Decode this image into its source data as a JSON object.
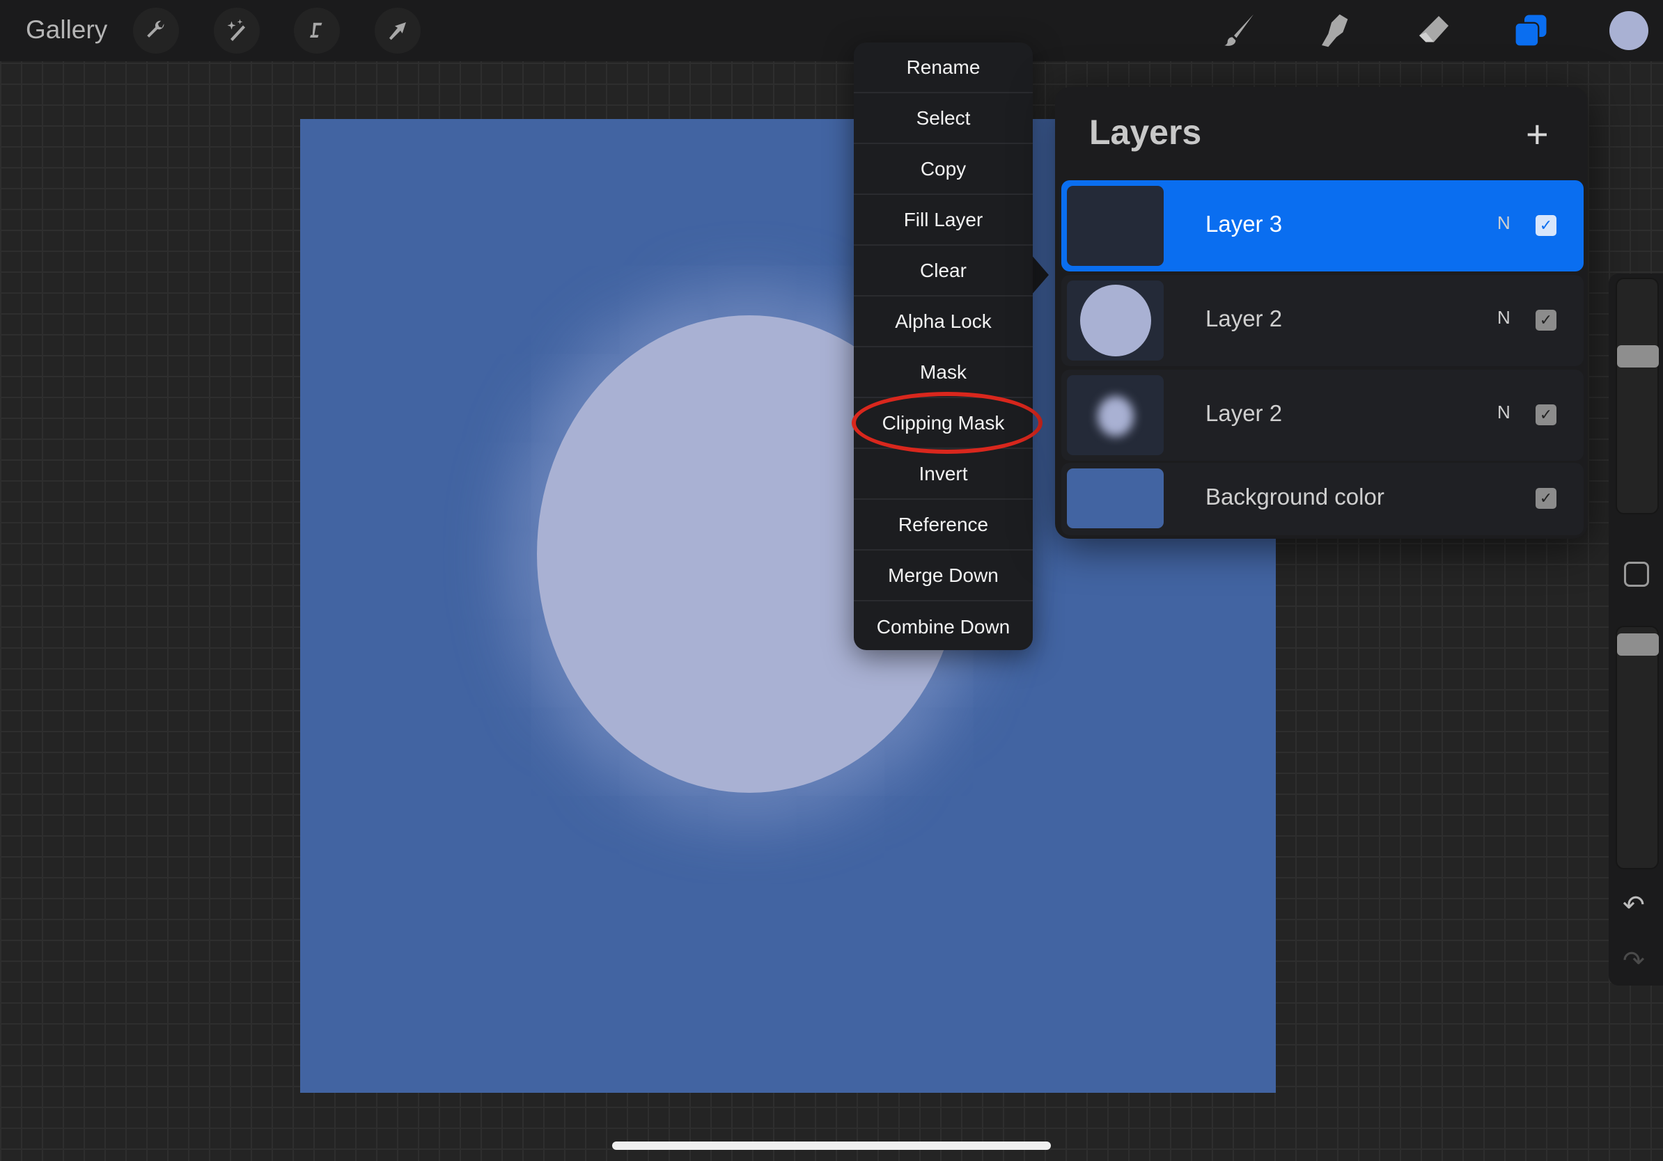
{
  "topbar": {
    "gallery_label": "Gallery",
    "left_tools": [
      "wrench-icon",
      "magic-wand-icon",
      "selection-icon",
      "move-arrow-icon"
    ],
    "right_tools": [
      "brush-icon",
      "smudge-icon",
      "eraser-icon",
      "layers-icon",
      "color-swatch"
    ],
    "accent": "#0a6ef0",
    "current_color": "#a9b1d3"
  },
  "context_menu": {
    "items": [
      "Rename",
      "Select",
      "Copy",
      "Fill Layer",
      "Clear",
      "Alpha Lock",
      "Mask",
      "Clipping Mask",
      "Invert",
      "Reference",
      "Merge Down",
      "Combine Down"
    ],
    "highlighted": "Clipping Mask"
  },
  "layers_panel": {
    "title": "Layers",
    "add_icon": "plus-icon",
    "layers": [
      {
        "name": "Layer 3",
        "blend": "N",
        "visible": true,
        "selected": true
      },
      {
        "name": "Layer 2",
        "blend": "N",
        "visible": true,
        "selected": false
      },
      {
        "name": "Layer 2",
        "blend": "N",
        "visible": true,
        "selected": false
      },
      {
        "name": "Background color",
        "blend": "",
        "visible": true,
        "selected": false
      }
    ]
  },
  "canvas": {
    "background": "#4264a2",
    "moon_color": "#a9b1d3"
  }
}
